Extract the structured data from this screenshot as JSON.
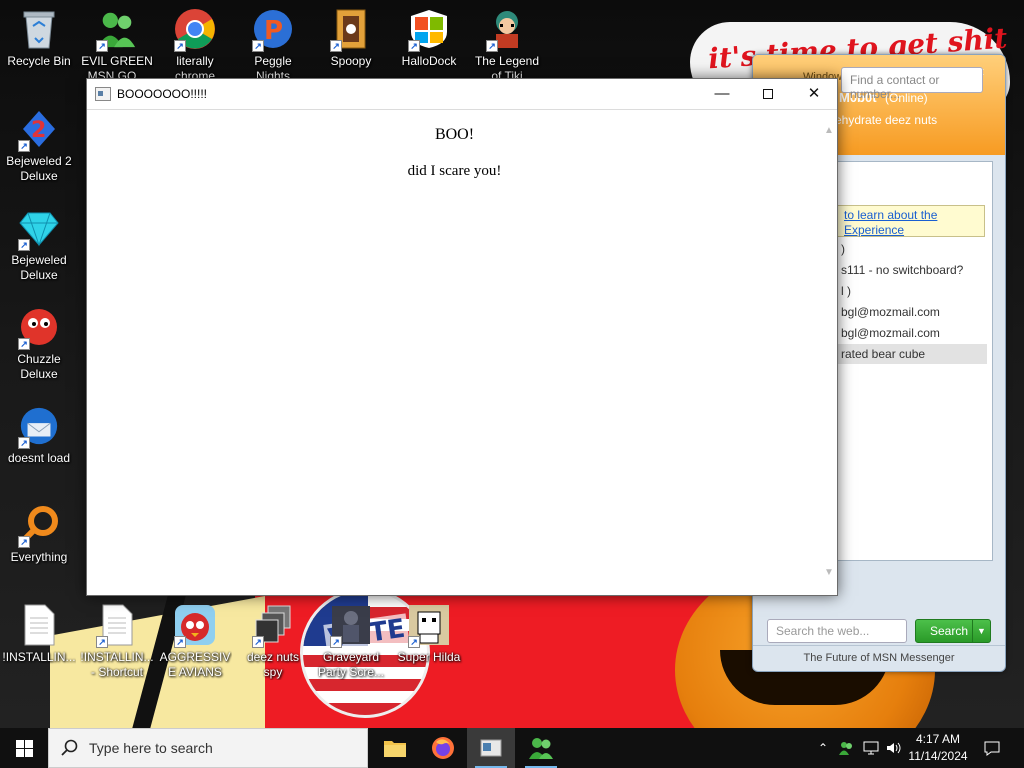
{
  "wallpaper": {
    "banner_text": "it's time to get shit",
    "vote_text": "VOTE"
  },
  "desktop_icons": [
    {
      "label": "Recycle Bin",
      "icon": "recycle-bin-icon"
    },
    {
      "label": "EVIL GREEN MSN GO...",
      "icon": "msn-buddy-icon"
    },
    {
      "label": "literally chrome",
      "icon": "chrome-icon"
    },
    {
      "label": "Peggle Nights Deluxe",
      "icon": "peggle-icon"
    },
    {
      "label": "Spoopy",
      "icon": "spoopy-icon"
    },
    {
      "label": "HalloDock",
      "icon": "windows-logo-icon"
    },
    {
      "label": "The Legend of Tiki",
      "icon": "tiki-icon"
    },
    {
      "label": "Bejeweled 2 Deluxe",
      "icon": "bejeweled2-icon"
    },
    {
      "label": "Bejeweled Deluxe",
      "icon": "diamond-icon"
    },
    {
      "label": "Chuzzle Deluxe",
      "icon": "chuzzle-icon"
    },
    {
      "label": "doesnt load",
      "icon": "thunderbird-icon"
    },
    {
      "label": "Everything",
      "icon": "everything-search-icon"
    },
    {
      "label": "!INSTALLIN...",
      "icon": "document-icon"
    },
    {
      "label": "!INSTALLIN... - Shortcut",
      "icon": "document-icon"
    },
    {
      "label": "AGGRESSIVE AVIANS",
      "icon": "angry-bird-icon"
    },
    {
      "label": "deez nuts spy",
      "icon": "windows-stack-icon"
    },
    {
      "label": "Graveyard Party Scre...",
      "icon": "graveyard-icon"
    },
    {
      "label": "Super Hilda",
      "icon": "hilda-icon"
    }
  ],
  "msn": {
    "title": "Windows Live Messenger",
    "user_name": "M0b0t",
    "status": "(Online)",
    "personal_message": "ehydrate deez nuts",
    "search_contacts_placeholder": "Find a contact or number...",
    "notice_text": "to learn about the Experience",
    "contacts": [
      ")",
      "s111 - no switchboard?",
      "l )",
      "bgl@mozmail.com",
      "bgl@mozmail.com",
      "rated bear cube"
    ],
    "web_search_placeholder": "Search the web...",
    "search_button": "Search",
    "footer": "The Future of MSN Messenger"
  },
  "popup": {
    "title": "BOOOOOOO!!!!!",
    "heading": "BOO!",
    "body": "did I scare you!",
    "minimize": "—",
    "close": "✕"
  },
  "taskbar": {
    "search_placeholder": "Type here to search",
    "apps": [
      "file-explorer-icon",
      "firefox-icon",
      "popup-app-icon",
      "msn-buddy-icon"
    ],
    "time": "4:17 AM",
    "date": "11/14/2024"
  }
}
